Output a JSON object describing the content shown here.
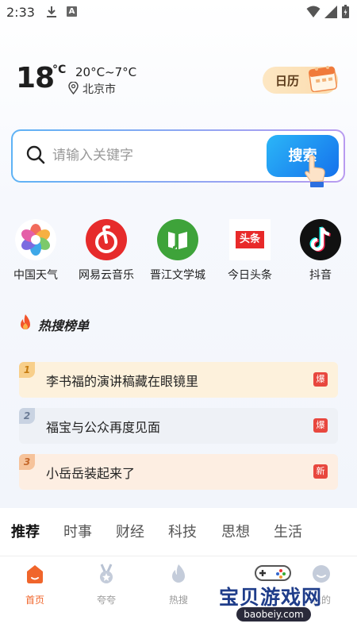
{
  "status_bar": {
    "time": "2:33"
  },
  "weather": {
    "temperature": "18",
    "unit": "°C",
    "range": "20°C~7°C",
    "location": "北京市",
    "calendar_label": "日历"
  },
  "search": {
    "placeholder": "请输入关键字",
    "button_label": "搜索"
  },
  "apps": [
    {
      "label": "中国天气",
      "icon": "china-weather-icon"
    },
    {
      "label": "网易云音乐",
      "icon": "netease-music-icon"
    },
    {
      "label": "晋江文学城",
      "icon": "jinjiang-icon"
    },
    {
      "label": "今日头条",
      "icon": "toutiao-icon",
      "icon_text": "头条"
    },
    {
      "label": "抖音",
      "icon": "douyin-icon"
    }
  ],
  "hot_list": {
    "title": "热搜榜单",
    "items": [
      {
        "rank": "1",
        "text": "李书福的演讲稿藏在眼镜里",
        "badge": "爆",
        "badge_color": "#e8473e",
        "bg": "#fdf1dc",
        "rank_bg": "#f8cf8a",
        "rank_color": "#c77d12"
      },
      {
        "rank": "2",
        "text": "福宝与公众再度见面",
        "badge": "爆",
        "badge_color": "#e8473e",
        "bg": "#eef1f6",
        "rank_bg": "#c9d3e2",
        "rank_color": "#6d7d97"
      },
      {
        "rank": "3",
        "text": "小岳岳装起来了",
        "badge": "新",
        "badge_color": "#e8473e",
        "bg": "#fdeee2",
        "rank_bg": "#f6c39b",
        "rank_color": "#c5672a"
      }
    ]
  },
  "categories": [
    "推荐",
    "时事",
    "财经",
    "科技",
    "思想",
    "生活"
  ],
  "bottom_nav": [
    {
      "label": "首页",
      "active": true
    },
    {
      "label": "夸夸",
      "active": false
    },
    {
      "label": "热搜",
      "active": false
    },
    {
      "label": "我的",
      "active": false
    }
  ],
  "watermark": {
    "text": "宝贝游戏网",
    "url": "baobeiy.com"
  },
  "colors": {
    "accent": "#f0652b",
    "search_blue": "#1571ec",
    "calendar_bg": "#fbdcae"
  }
}
